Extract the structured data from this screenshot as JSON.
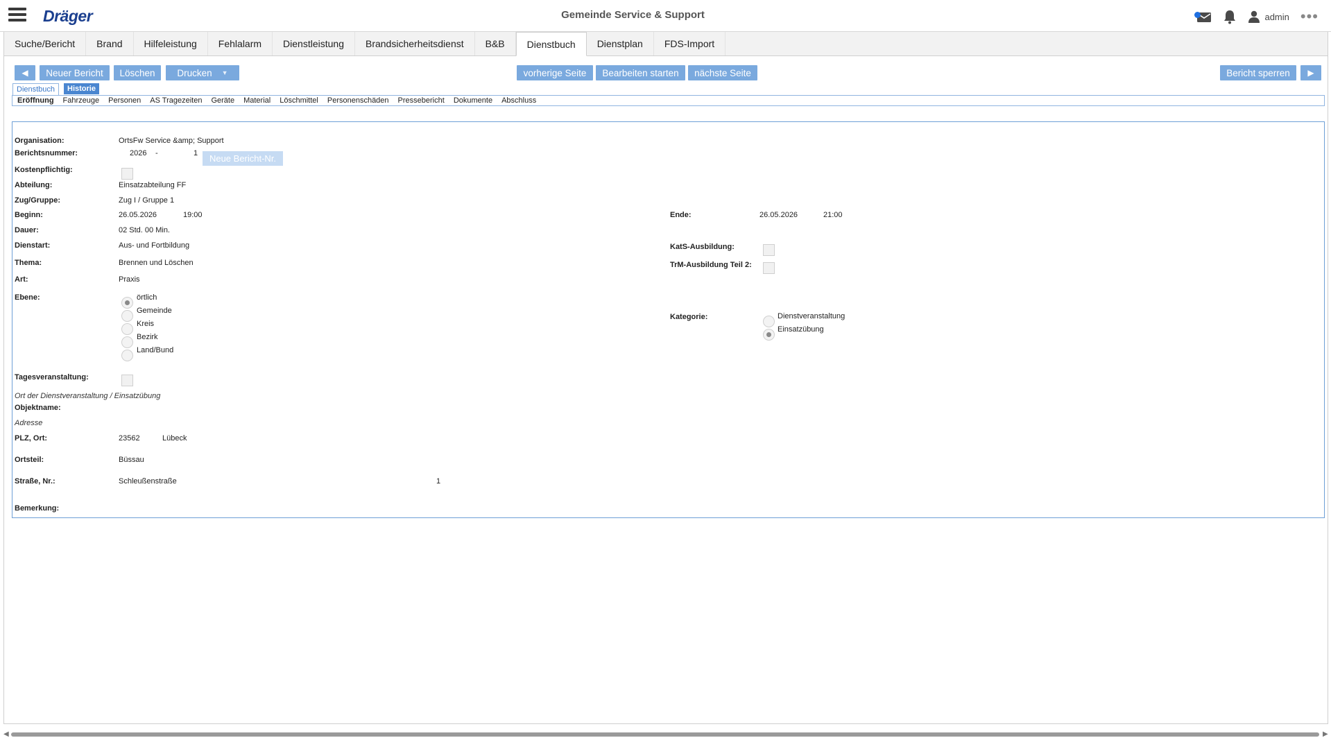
{
  "header": {
    "logo": "Dräger",
    "title": "Gemeinde Service & Support",
    "user": "admin",
    "more": "•••"
  },
  "tabs": [
    "Suche/Bericht",
    "Brand",
    "Hilfeleistung",
    "Fehlalarm",
    "Dienstleistung",
    "Brandsicherheitsdienst",
    "B&B",
    "Dienstbuch",
    "Dienstplan",
    "FDS-Import"
  ],
  "active_tab": "Dienstbuch",
  "toolbar": {
    "prev_arrow": "◀",
    "neuer_bericht": "Neuer Bericht",
    "loeschen": "Löschen",
    "drucken": "Drucken",
    "vorherige_seite": "vorherige Seite",
    "bearbeiten_starten": "Bearbeiten starten",
    "naechste_seite": "nächste Seite",
    "bericht_sperren": "Bericht sperren",
    "next_arrow": "▶"
  },
  "subtabs": {
    "dienstbuch": "Dienstbuch",
    "historie": "Historie"
  },
  "sections": [
    "Eröffnung",
    "Fahrzeuge",
    "Personen",
    "AS Tragezeiten",
    "Geräte",
    "Material",
    "Löschmittel",
    "Personenschäden",
    "Pressebericht",
    "Dokumente",
    "Abschluss"
  ],
  "form": {
    "organisation": {
      "label": "Organisation:",
      "value": "OrtsFw Service &amp; Support"
    },
    "berichtsnummer": {
      "label": "Berichtsnummer:",
      "year": "2026",
      "sep": "-",
      "number": "1",
      "new_button": "Neue Bericht-Nr."
    },
    "kostenpflichtig": {
      "label": "Kostenpflichtig:",
      "checked": false
    },
    "abteilung": {
      "label": "Abteilung:",
      "value": "Einsatzabteilung FF"
    },
    "zug_gruppe": {
      "label": "Zug/Gruppe:",
      "value": "Zug I / Gruppe 1"
    },
    "beginn": {
      "label": "Beginn:",
      "date": "26.05.2026",
      "time": "19:00"
    },
    "ende": {
      "label": "Ende:",
      "date": "26.05.2026",
      "time": "21:00"
    },
    "dauer": {
      "label": "Dauer:",
      "value": "02 Std. 00 Min."
    },
    "dienstart": {
      "label": "Dienstart:",
      "value": "Aus- und Fortbildung"
    },
    "kats_ausbildung": {
      "label": "KatS-Ausbildung:",
      "checked": false
    },
    "thema": {
      "label": "Thema:",
      "value": "Brennen und Löschen"
    },
    "trm_ausbildung": {
      "label": "TrM-Ausbildung Teil 2:",
      "checked": false
    },
    "art": {
      "label": "Art:",
      "value": "Praxis"
    },
    "ebene": {
      "label": "Ebene:",
      "options": [
        "örtlich",
        "Gemeinde",
        "Kreis",
        "Bezirk",
        "Land/Bund"
      ],
      "selected": "örtlich"
    },
    "kategorie": {
      "label": "Kategorie:",
      "options": [
        "Dienstveranstaltung",
        "Einsatzübung"
      ],
      "selected": "Einsatzübung"
    },
    "tagesveranstaltung": {
      "label": "Tagesveranstaltung:",
      "checked": false
    },
    "ort_hint": "Ort der Dienstveranstaltung / Einsatzübung",
    "objektname": {
      "label": "Objektname:",
      "value": ""
    },
    "adresse_hint": "Adresse",
    "plz_ort": {
      "label": "PLZ, Ort:",
      "plz": "23562",
      "ort": "Lübeck"
    },
    "ortsteil": {
      "label": "Ortsteil:",
      "value": "Büssau"
    },
    "strasse": {
      "label": "Straße, Nr.:",
      "street": "Schleußenstraße",
      "number": "1"
    },
    "bemerkung": {
      "label": "Bemerkung:",
      "value": ""
    }
  },
  "scrollbar": {
    "left": "◀",
    "right": "▶"
  }
}
